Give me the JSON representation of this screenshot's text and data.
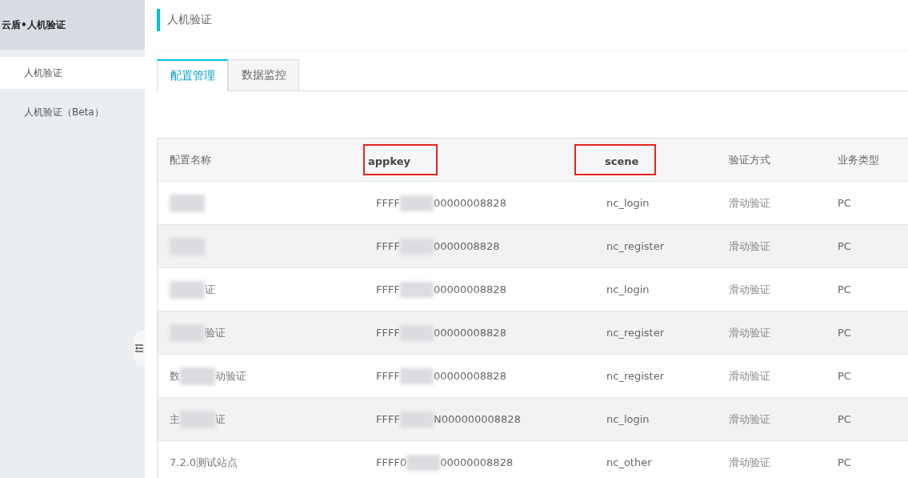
{
  "sidebar": {
    "title": "云盾•人机验证",
    "items": [
      {
        "label": "人机验证",
        "selected": true
      },
      {
        "label": "人机验证（Beta）",
        "selected": false
      }
    ]
  },
  "page_title": "人机验证",
  "tabs": [
    {
      "label": "配置管理",
      "selected": true
    },
    {
      "label": "数据监控",
      "selected": false
    }
  ],
  "table": {
    "columns": [
      {
        "label": "配置名称",
        "highlighted": false
      },
      {
        "label": "appkey",
        "highlighted": true
      },
      {
        "label": "scene",
        "highlighted": true
      },
      {
        "label": "验证方式",
        "highlighted": false
      },
      {
        "label": "业务类型",
        "highlighted": false
      }
    ],
    "rows": [
      {
        "name_end": "",
        "appkey_start": "FFFF",
        "appkey_end": "00000008828",
        "scene": "nc_login",
        "method": "滑动验证",
        "type": "PC"
      },
      {
        "name_end": "",
        "appkey_start": "FFFF",
        "appkey_end": "0000008828",
        "scene": "nc_register",
        "method": "滑动验证",
        "type": "PC"
      },
      {
        "name_end": "证",
        "appkey_start": "FFFF",
        "appkey_end": "00000008828",
        "scene": "nc_login",
        "method": "滑动验证",
        "type": "PC"
      },
      {
        "name_end": "验证",
        "appkey_start": "FFFF",
        "appkey_end": "00000008828",
        "scene": "nc_register",
        "method": "滑动验证",
        "type": "PC"
      },
      {
        "name_start": "数",
        "name_end": "动验证",
        "appkey_start": "FFFF",
        "appkey_end": "00000008828",
        "scene": "nc_register",
        "method": "滑动验证",
        "type": "PC"
      },
      {
        "name_start": "主",
        "name_end": "证",
        "appkey_start": "FFFF",
        "appkey_end": "N000000008828",
        "scene": "nc_login",
        "method": "滑动验证",
        "type": "PC"
      },
      {
        "name_start": "7.2.0测试站点",
        "appkey_start": "FFFF0",
        "appkey_end": "00000008828",
        "scene": "nc_other",
        "method": "滑动验证",
        "type": "PC"
      }
    ]
  }
}
